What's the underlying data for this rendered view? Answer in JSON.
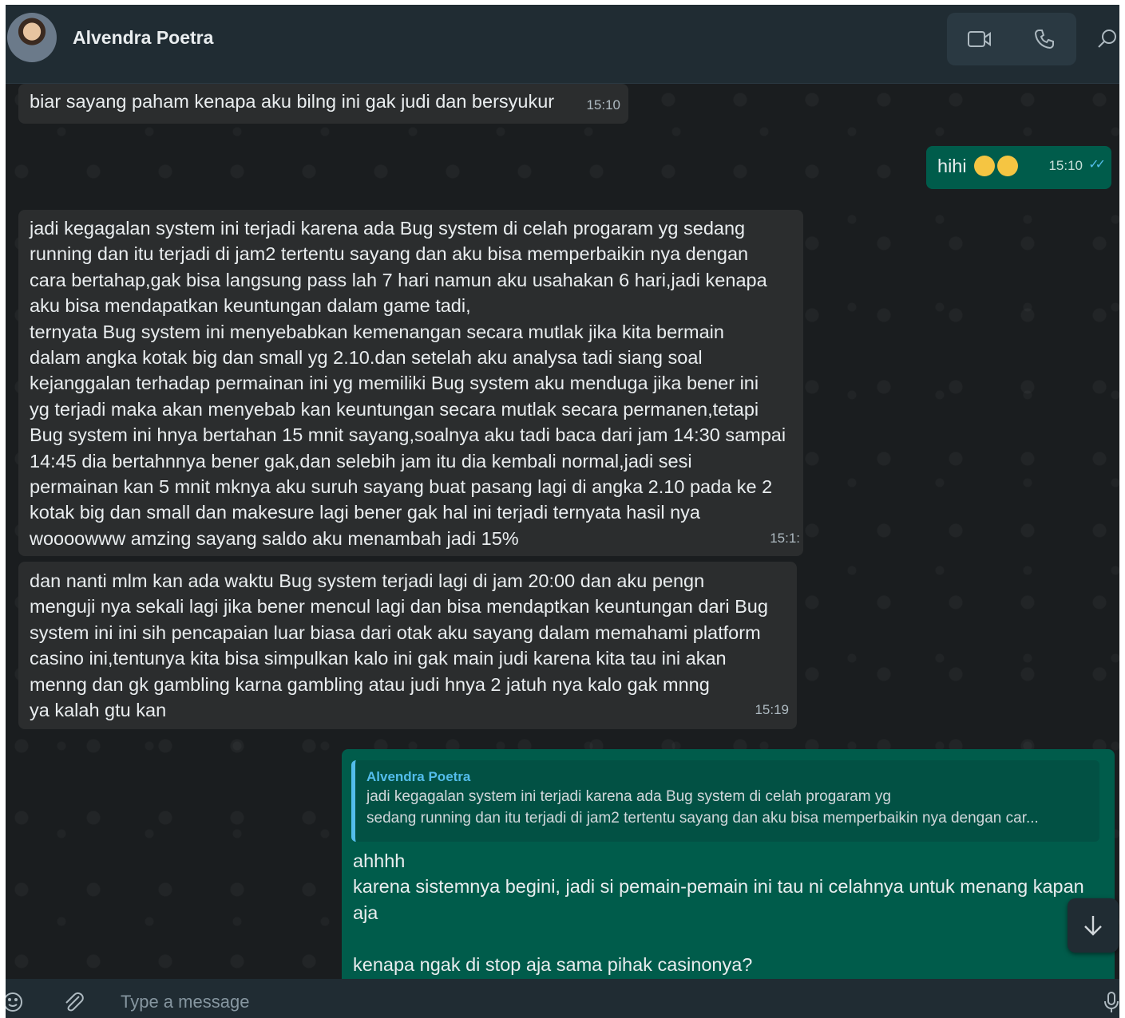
{
  "header": {
    "contact_name": "Alvendra Poetra",
    "icons": [
      "video-call-icon",
      "voice-call-icon",
      "search-icon"
    ]
  },
  "messages": [
    {
      "direction": "incoming",
      "text": "biar sayang paham kenapa aku bilng ini gak judi dan bersyukur",
      "time": "15:10"
    },
    {
      "direction": "outgoing",
      "text": "hihi",
      "emoji": [
        "grinning-squinting-face",
        "grinning-squinting-face"
      ],
      "time": "15:10",
      "status": "read"
    },
    {
      "direction": "incoming",
      "text": "jadi kegagalan system ini terjadi karena ada Bug system di celah progaram yg sedang\nrunning dan itu terjadi di jam2 tertentu sayang dan aku bisa memperbaikin nya dengan\ncara bertahap,gak bisa langsung pass lah 7 hari namun aku usahakan 6 hari,jadi kenapa\naku bisa mendapatkan keuntungan dalam game tadi,\nternyata Bug system ini menyebabkan kemenangan secara mutlak jika kita bermain\ndalam angka kotak big dan small yg 2.10.dan setelah aku analysa tadi siang soal\nkejanggalan terhadap permainan ini yg memiliki Bug system aku menduga jika bener ini\nyg terjadi maka akan menyebab kan keuntungan secara mutlak secara permanen,tetapi\nBug system ini hnya bertahan 15 mnit sayang,soalnya aku tadi baca dari jam 14:30 sampai\n14:45 dia bertahnnya bener gak,dan selebih jam itu dia kembali normal,jadi sesi\npermainan kan 5 mnit mknya aku suruh sayang buat pasang lagi di angka 2.10 pada ke 2\nkotak big dan small dan makesure lagi bener gak hal ini terjadi ternyata hasil nya\nwoooowww amzing sayang saldo aku menambah jadi 15%",
      "time": "15:1:"
    },
    {
      "direction": "incoming",
      "text": "dan nanti mlm kan ada waktu Bug system terjadi lagi di jam 20:00 dan aku pengn\nmenguji nya sekali lagi jika bener mencul lagi dan bisa mendaptkan keuntungan dari Bug\nsystem ini ini sih pencapaian luar biasa dari otak aku sayang dalam memahami platform\ncasino ini,tentunya kita bisa simpulkan kalo ini gak main judi karena kita tau ini akan\nmenng dan gk gambling karna gambling atau judi hnya 2 jatuh nya kalo gak mnng\nya kalah gtu kan",
      "time": "15:19"
    },
    {
      "direction": "outgoing",
      "quote": {
        "author": "Alvendra Poetra",
        "text": "jadi kegagalan system ini terjadi karena ada Bug system di celah progaram yg\nsedang running dan itu terjadi di jam2 tertentu sayang dan aku bisa memperbaikin nya dengan car..."
      },
      "text": "ahhhh\nkarena sistemnya begini, jadi si pemain-pemain ini tau ni celahnya untuk menang kapan\naja\n\nkenapa ngak di stop aja sama pihak casinonya?"
    }
  ],
  "footer": {
    "placeholder": "Type a message",
    "value": ""
  }
}
